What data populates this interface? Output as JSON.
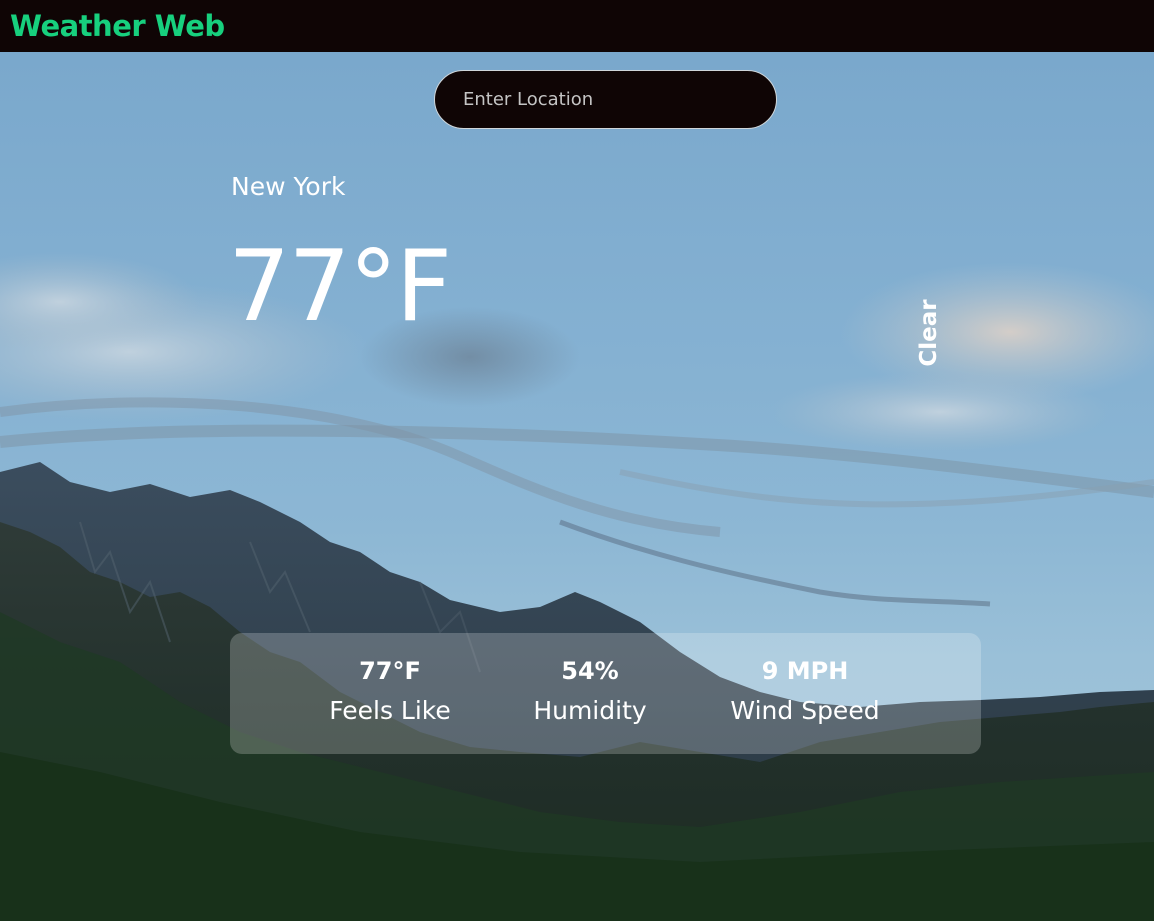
{
  "app": {
    "title": "Weather Web"
  },
  "search": {
    "placeholder": "Enter Location",
    "value": ""
  },
  "location": {
    "name": "New York"
  },
  "current": {
    "temperature": "77°F",
    "condition": "Clear"
  },
  "stats": [
    {
      "value": "77°F",
      "label": "Feels Like"
    },
    {
      "value": "54%",
      "label": "Humidity"
    },
    {
      "value": "9 MPH",
      "label": "Wind Speed"
    }
  ],
  "colors": {
    "brand": "#17d07e",
    "header_bg": "#0f0505",
    "input_bg": "#0f0505",
    "text": "#ffffff"
  }
}
